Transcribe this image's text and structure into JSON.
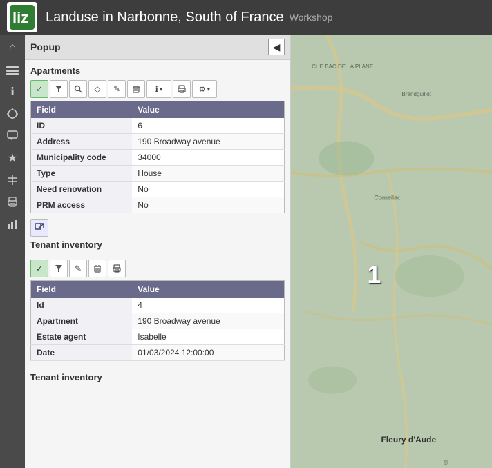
{
  "header": {
    "title": "Landuse in Narbonne, South of France",
    "workshop": "Workshop",
    "logo": "liz"
  },
  "sidebar": {
    "icons": [
      {
        "name": "home-icon",
        "symbol": "⌂"
      },
      {
        "name": "layers-icon",
        "symbol": "⊞"
      },
      {
        "name": "info-icon",
        "symbol": "ℹ"
      },
      {
        "name": "pin-icon",
        "symbol": "📍"
      },
      {
        "name": "comment-icon",
        "symbol": "💬"
      },
      {
        "name": "star-icon",
        "symbol": "★"
      },
      {
        "name": "tools-icon",
        "symbol": "⚒"
      },
      {
        "name": "print-icon",
        "symbol": "🖨"
      },
      {
        "name": "chart-icon",
        "symbol": "📊"
      }
    ]
  },
  "popup": {
    "title": "Popup",
    "back_button": "◀",
    "apartments_section": {
      "title": "Apartments",
      "toolbar": {
        "check": "✓",
        "filter": "▼",
        "zoom": "🔍",
        "shape": "◇",
        "edit": "✎",
        "delete": "🗑",
        "info_dropdown": "ℹ▾",
        "print": "🖨",
        "settings_dropdown": "⚙▾"
      },
      "table": {
        "headers": [
          "Field",
          "Value"
        ],
        "rows": [
          {
            "field": "ID",
            "value": "6"
          },
          {
            "field": "Address",
            "value": "190 Broadway avenue"
          },
          {
            "field": "Municipality code",
            "value": "34000"
          },
          {
            "field": "Type",
            "value": "House"
          },
          {
            "field": "Need renovation",
            "value": "No"
          },
          {
            "field": "PRM access",
            "value": "No"
          }
        ]
      }
    },
    "tenant_inventory_link": {
      "icon": "↗",
      "label": "Tenant inventory"
    },
    "tenant_table_1": {
      "title": "Tenant inventory",
      "toolbar": {
        "check": "✓",
        "filter": "▼",
        "edit": "✎",
        "delete": "🗑",
        "print": "🖨"
      },
      "table": {
        "headers": [
          "Field",
          "Value"
        ],
        "rows": [
          {
            "field": "Id",
            "value": "4"
          },
          {
            "field": "Apartment",
            "value": "190 Broadway avenue"
          },
          {
            "field": "Estate agent",
            "value": "Isabelle"
          },
          {
            "field": "Date",
            "value": "01/03/2024 12:00:00"
          }
        ]
      }
    },
    "tenant_table_2_title": "Tenant inventory"
  },
  "map": {
    "number_marker": "1",
    "place_label": "Fleury d'Aude",
    "attribution": "©"
  }
}
